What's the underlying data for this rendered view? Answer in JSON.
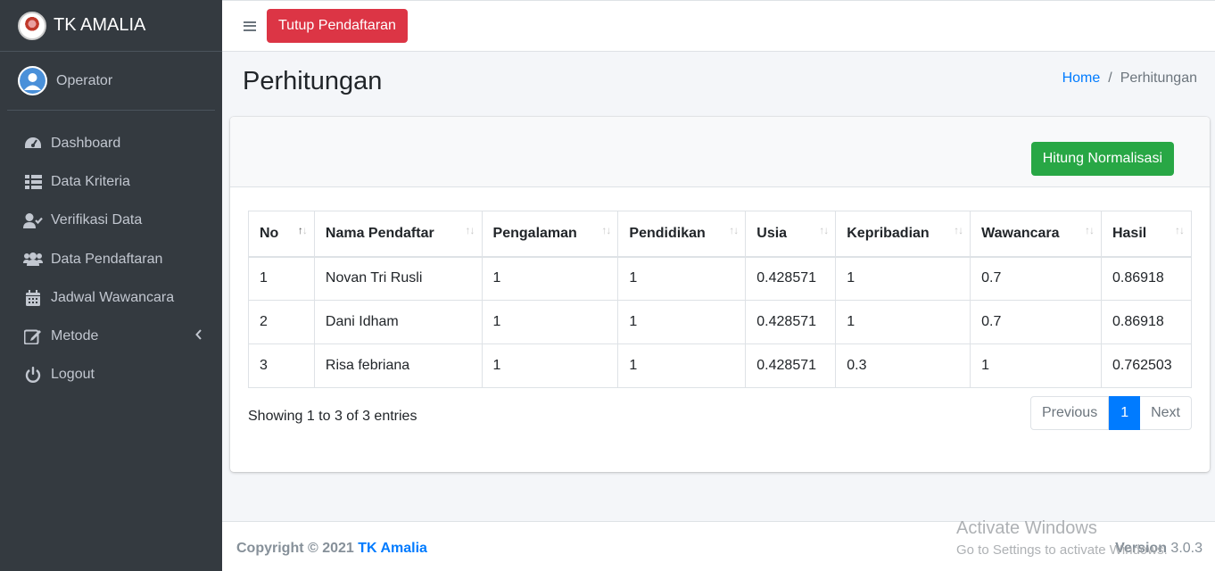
{
  "brand": {
    "name": "TK AMALIA",
    "logo_icon": "school-logo"
  },
  "user": {
    "name": "Operator",
    "avatar_icon": "user-avatar-icon"
  },
  "sidebar": {
    "items": [
      {
        "label": "Dashboard",
        "icon": "tachometer-icon"
      },
      {
        "label": "Data Kriteria",
        "icon": "table-list-icon"
      },
      {
        "label": "Verifikasi Data",
        "icon": "user-check-icon"
      },
      {
        "label": "Data Pendaftaran",
        "icon": "users-icon"
      },
      {
        "label": "Jadwal Wawancara",
        "icon": "calendar-icon"
      },
      {
        "label": "Metode",
        "icon": "edit-icon"
      },
      {
        "label": "Logout",
        "icon": "power-icon"
      }
    ]
  },
  "topbar": {
    "close_registration_label": "Tutup Pendaftaran"
  },
  "page": {
    "title": "Perhitungan",
    "breadcrumb": {
      "home": "Home",
      "separator": "/",
      "current": "Perhitungan"
    }
  },
  "card": {
    "normalize_button": "Hitung Normalisasi"
  },
  "table": {
    "headers": [
      "No",
      "Nama Pendaftar",
      "Pengalaman",
      "Pendidikan",
      "Usia",
      "Kepribadian",
      "Wawancara",
      "Hasil"
    ],
    "rows": [
      [
        "1",
        "Novan Tri Rusli",
        "1",
        "1",
        "0.428571",
        "1",
        "0.7",
        "0.86918"
      ],
      [
        "2",
        "Dani Idham",
        "1",
        "1",
        "0.428571",
        "1",
        "0.7",
        "0.86918"
      ],
      [
        "3",
        "Risa febriana",
        "1",
        "1",
        "0.428571",
        "0.3",
        "1",
        "0.762503"
      ]
    ],
    "info": "Showing 1 to 3 of 3 entries"
  },
  "pagination": {
    "previous": "Previous",
    "current_page": "1",
    "next": "Next"
  },
  "footer": {
    "copyright_prefix": "Copyright © 2021 ",
    "copyright_link": "TK Amalia",
    "version_label": "Version",
    "version_number": " 3.0.3"
  },
  "watermark": {
    "title": "Activate Windows",
    "subtitle": "Go to Settings to activate Windows."
  },
  "colors": {
    "sidebar": "#343a40",
    "danger": "#dc3545",
    "success": "#28a745",
    "primary": "#007bff"
  }
}
